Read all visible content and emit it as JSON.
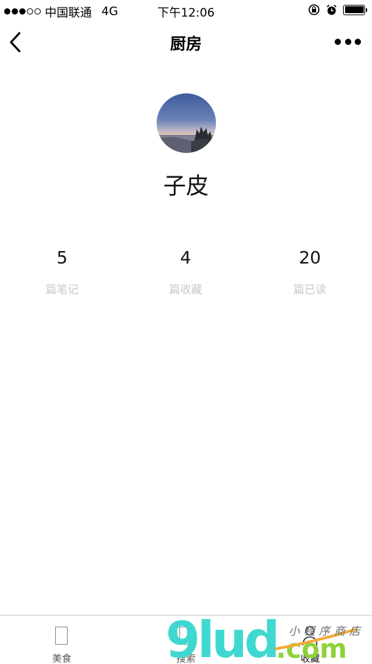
{
  "status_bar": {
    "carrier": "中国联通",
    "network": "4G",
    "time": "下午12:06",
    "battery_level": 1.0
  },
  "nav": {
    "title": "厨房"
  },
  "profile": {
    "username": "子皮"
  },
  "stats": [
    {
      "value": "5",
      "label": "篇笔记"
    },
    {
      "value": "4",
      "label": "篇收藏"
    },
    {
      "value": "20",
      "label": "篇已读"
    }
  ],
  "tabs": [
    {
      "label": "美食",
      "icon": "food-icon"
    },
    {
      "label": "搜索",
      "icon": "search-icon"
    },
    {
      "label": "收藏",
      "icon": "favorites-icon"
    }
  ],
  "watermark": {
    "logo_text": "9lud",
    "domain": ".com",
    "tagline": "小程序商店"
  },
  "colors": {
    "stat_label": "#c8c8c8",
    "watermark_cyan": "#3fd8d0",
    "watermark_green": "#8ed23a",
    "watermark_orange": "#f2a93b"
  }
}
